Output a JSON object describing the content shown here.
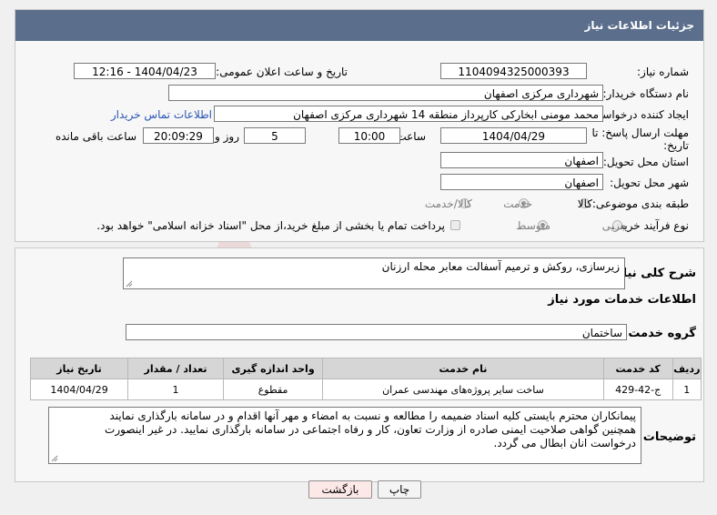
{
  "header": {
    "title": "جزئیات اطلاعات نیاز"
  },
  "fields": {
    "need_number_label": "شماره نیاز:",
    "need_number": "1104094325000393",
    "announce_label": "تاریخ و ساعت اعلان عمومی:",
    "announce_value": "1404/04/23 - 12:16",
    "buyer_org_label": "نام دستگاه خریدار:",
    "buyer_org": "شهرداری مرکزی اصفهان",
    "requester_label": "ایجاد کننده درخواست:",
    "requester": "محمد مومنی ابخارکی کارپرداز منطقه 14 شهرداری مرکزی اصفهان",
    "contact_link": "اطلاعات تماس خریدار",
    "deadline_label_1": "مهلت ارسال پاسخ: تا",
    "deadline_label_2": "تاریخ:",
    "deadline_date": "1404/04/29",
    "time_label": "ساعت",
    "deadline_time": "10:00",
    "days_value": "5",
    "days_label": "روز و",
    "remaining_time": "20:09:29",
    "remaining_label": "ساعت باقی مانده",
    "province_label": "استان محل تحویل:",
    "province": "اصفهان",
    "city_label": "شهر محل تحویل:",
    "city": "اصفهان",
    "category_label": "طبقه بندی موضوعی:",
    "category_options": [
      "کالا",
      "خدمت",
      "کالا/خدمت"
    ],
    "category_selected": "خدمت",
    "process_label": "نوع فرآیند خرید :",
    "process_options": [
      "جزیی",
      "متوسط"
    ],
    "process_selected": "متوسط",
    "payment_note": "پرداخت تمام یا بخشی از مبلغ خرید،از محل \"اسناد خزانه اسلامی\" خواهد بود."
  },
  "summary": {
    "label": "شرح کلی نیاز:",
    "text": "زیرسازی، روکش و ترمیم آسفالت معابر محله ارزنان"
  },
  "services": {
    "section_title": "اطلاعات خدمات مورد نیاز",
    "group_label": "گروه خدمت:",
    "group_value": "ساختمان",
    "columns": [
      "ردیف",
      "کد خدمت",
      "نام خدمت",
      "واحد اندازه گیری",
      "تعداد / مقدار",
      "تاریخ نیاز"
    ],
    "rows": [
      [
        "1",
        "ج-42-429",
        "ساخت سایر پروژه‌های مهندسی عمران",
        "مقطوع",
        "1",
        "1404/04/29"
      ]
    ]
  },
  "notes": {
    "label": "توضیحات خریدار:",
    "line1": "پیمانکاران محترم بایستی کلیه اسناد ضمیمه را مطالعه و نسبت به امضاء و مهر آنها اقدام و در سامانه بارگذاری نمایند",
    "line2": "همچنین گواهی صلاحیت ایمنی صادره از وزارت تعاون، کار و رفاه اجتماعی در سامانه بارگذاری نمایید. در غیر اینصورت",
    "line3": "درخواست انان ابطال می گردد."
  },
  "buttons": {
    "print": "چاپ",
    "back": "بازگشت"
  },
  "watermark": {
    "text": "AriaTender.neT"
  },
  "colors": {
    "header_bg": "#5b6f8c",
    "link": "#2a55b4",
    "back_button_bg": "#fde8e8"
  }
}
